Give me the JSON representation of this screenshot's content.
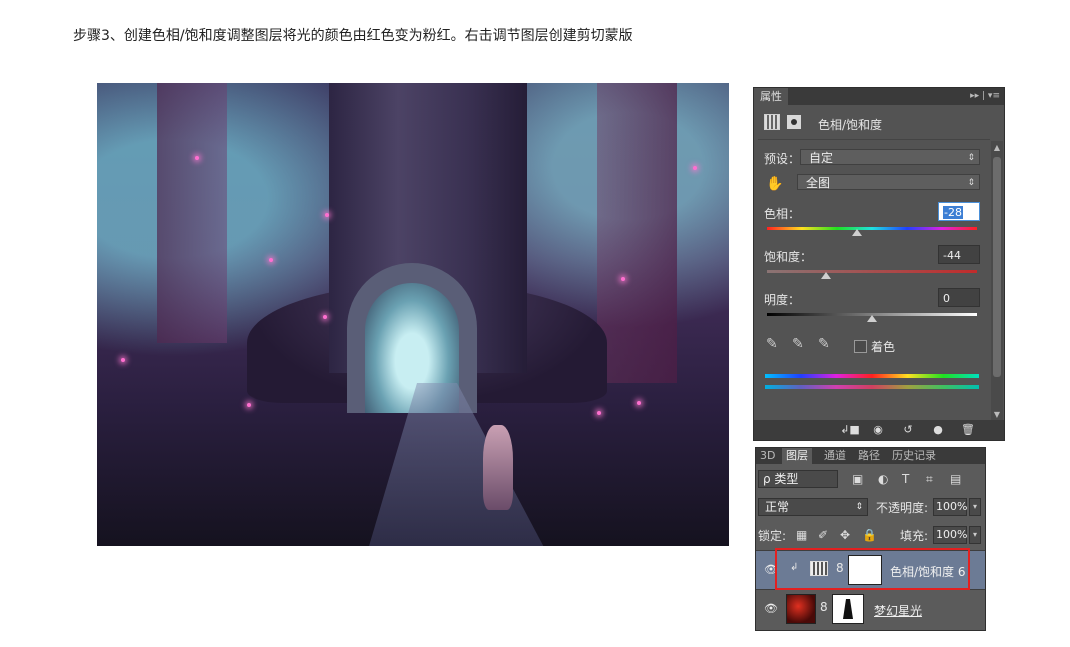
{
  "caption": "步骤3、创建色相/饱和度调整图层将光的颜色由红色变为粉红。右击调节图层创建剪切蒙版",
  "properties_panel": {
    "tab": "属性",
    "menu_icons": "▸▸ | ▾≡",
    "title": "色相/饱和度",
    "preset_label": "预设：",
    "preset_value": "自定",
    "range_value": "全图",
    "hue_label": "色相：",
    "hue_value": "-28",
    "hue_fraction": 0.43,
    "saturation_label": "饱和度：",
    "saturation_value": "-44",
    "saturation_fraction": 0.28,
    "lightness_label": "明度：",
    "lightness_value": "0",
    "lightness_fraction": 0.5,
    "colorize_label": "着色",
    "colorize_checked": false
  },
  "layers_panel": {
    "tabs": [
      {
        "label": "3D",
        "active": false
      },
      {
        "label": "图层",
        "active": true
      },
      {
        "label": "通道",
        "active": false
      },
      {
        "label": "路径",
        "active": false
      },
      {
        "label": "历史记录",
        "active": false
      }
    ],
    "filter_label": "ρ 类型",
    "blend_mode": "正常",
    "opacity_label": "不透明度:",
    "opacity_value": "100%",
    "lock_label": "锁定:",
    "fill_label": "填充:",
    "fill_value": "100%",
    "layers": [
      {
        "name": "色相/饱和度 6",
        "selected": true
      },
      {
        "name": "梦幻星光",
        "selected": false
      }
    ]
  },
  "colors": {
    "panel_bg": "#535353",
    "selected_layer": "#6c7b95",
    "highlight_box": "#e32020"
  }
}
